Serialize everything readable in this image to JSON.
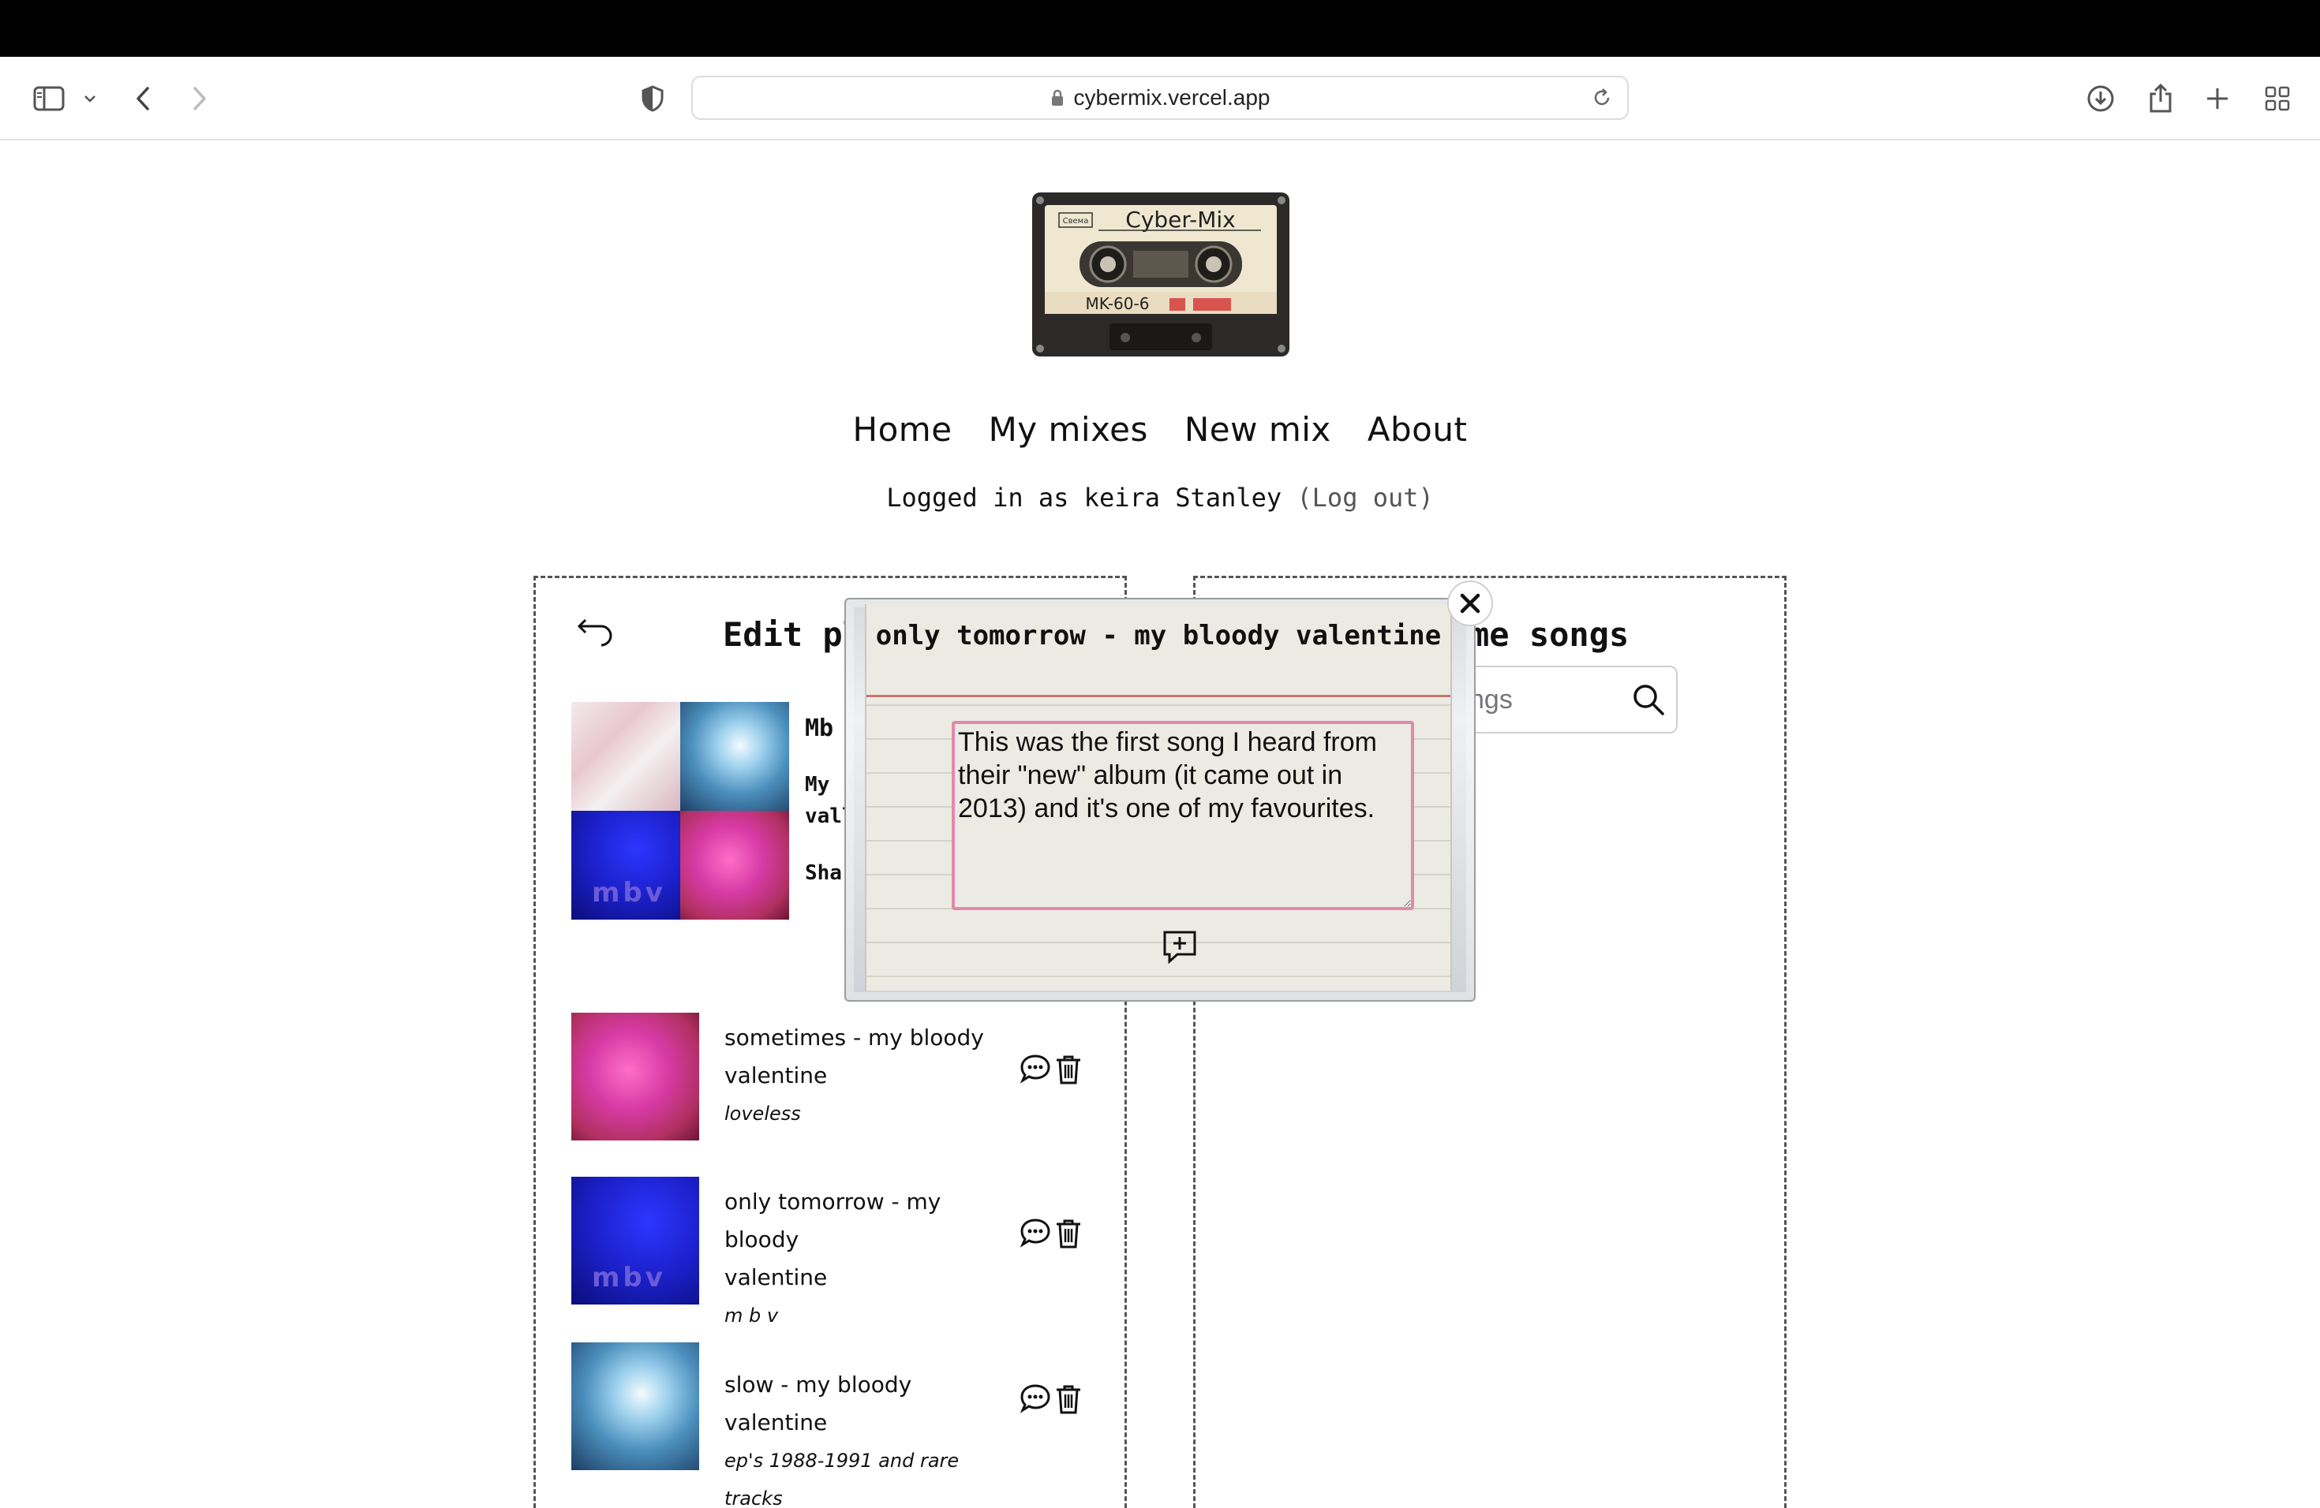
{
  "browser": {
    "url": "cybermix.vercel.app",
    "icons": [
      "sidebar-icon",
      "chevron-down-icon",
      "back-icon",
      "forward-icon",
      "shield-icon",
      "lock-icon",
      "reload-icon",
      "download-icon",
      "share-icon",
      "new-tab-icon",
      "tab-overview-icon"
    ]
  },
  "site": {
    "logo": {
      "label": "Cyber-Mix",
      "model": "MK-60-6"
    },
    "nav": [
      "Home",
      "My mixes",
      "New mix",
      "About"
    ],
    "login": {
      "prefix": "Logged in as",
      "user": "keira Stanley",
      "logout": "(Log out)"
    }
  },
  "left_panel": {
    "title": "Edit pla",
    "mix_name": "Mb",
    "mix_desc_1": "My",
    "mix_desc_2": "vall",
    "share": "Sha"
  },
  "songs": [
    {
      "title_line1": "sometimes - my bloody",
      "title_line2": "valentine",
      "album": "loveless",
      "art": "pink"
    },
    {
      "title_line1": "only tomorrow - my bloody",
      "title_line2": "valentine",
      "album": "m b v",
      "art": "mbv"
    },
    {
      "title_line1": "slow - my bloody valentine",
      "title_line2": "",
      "album": "ep's 1988-1991 and rare tracks",
      "art": "blue"
    }
  ],
  "right_panel": {
    "title": "me songs",
    "search_placeholder": "ngs"
  },
  "modal": {
    "title": "only tomorrow - my bloody valentine",
    "note": "This was the first song I heard from their \"new\" album (it came out in 2013) and it's one of my favourites.",
    "close_symbol": "✕"
  },
  "colors": {
    "note_border": "#e487ad",
    "header_rule": "#c7746c",
    "card_bg": "#ecebe3"
  }
}
